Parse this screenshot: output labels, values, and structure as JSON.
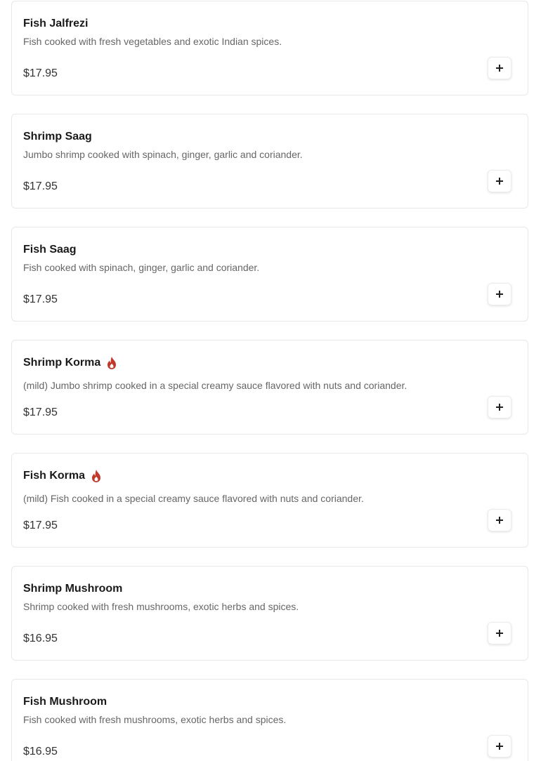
{
  "accent_color": "#c0392b",
  "menu_items": [
    {
      "name": "Fish Jalfrezi",
      "description": "Fish cooked with fresh vegetables and exotic Indian spices.",
      "price": "$17.95",
      "spicy": false,
      "add_icon": "plus-icon"
    },
    {
      "name": "Shrimp Saag",
      "description": "Jumbo shrimp cooked with spinach, ginger, garlic and coriander.",
      "price": "$17.95",
      "spicy": false,
      "add_icon": "plus-icon"
    },
    {
      "name": "Fish Saag",
      "description": "Fish cooked with spinach, ginger, garlic and coriander.",
      "price": "$17.95",
      "spicy": false,
      "add_icon": "plus-icon"
    },
    {
      "name": "Shrimp Korma",
      "description": "(mild) Jumbo shrimp cooked in a special creamy sauce flavored with nuts and coriander.",
      "price": "$17.95",
      "spicy": true,
      "badge_icon": "flame-icon",
      "add_icon": "plus-icon"
    },
    {
      "name": "Fish Korma",
      "description": "(mild) Fish cooked in a special creamy sauce flavored with nuts and coriander.",
      "price": "$17.95",
      "spicy": true,
      "badge_icon": "flame-icon",
      "add_icon": "plus-icon"
    },
    {
      "name": "Shrimp Mushroom",
      "description": "Shrimp cooked with fresh mushrooms, exotic herbs and spices.",
      "price": "$16.95",
      "spicy": false,
      "add_icon": "plus-icon"
    },
    {
      "name": "Fish Mushroom",
      "description": "Fish cooked with fresh mushrooms, exotic herbs and spices.",
      "price": "$16.95",
      "spicy": false,
      "add_icon": "plus-icon"
    }
  ]
}
